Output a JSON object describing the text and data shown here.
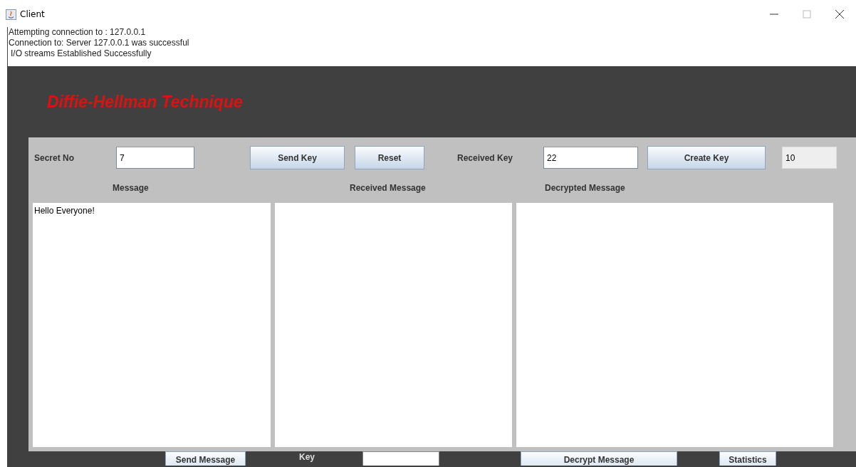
{
  "window": {
    "title": "Client"
  },
  "log": [
    "Attempting connection to : 127.0.0.1",
    "Connection to: Server 127.0.0.1 was successful",
    "I/O streams Established Successfully"
  ],
  "heading": "Diffie-Hellman Technique",
  "key_row": {
    "secret_label": "Secret No",
    "secret_value": "7",
    "send_key": "Send Key",
    "reset": "Reset",
    "received_label": "Received Key",
    "received_value": "22",
    "create_key": "Create Key",
    "shared_key": {
      "value": "10",
      "editable": false
    }
  },
  "panes": [
    {
      "label": "Message",
      "value": "Hello Everyone!"
    },
    {
      "label": "Received Message"
    },
    {
      "label": "Decrypted Message"
    }
  ],
  "bottom": {
    "send_message": "Send Message",
    "key_label": "Key",
    "decrypt": "Decrypt Message",
    "statistics": "Statistics"
  }
}
